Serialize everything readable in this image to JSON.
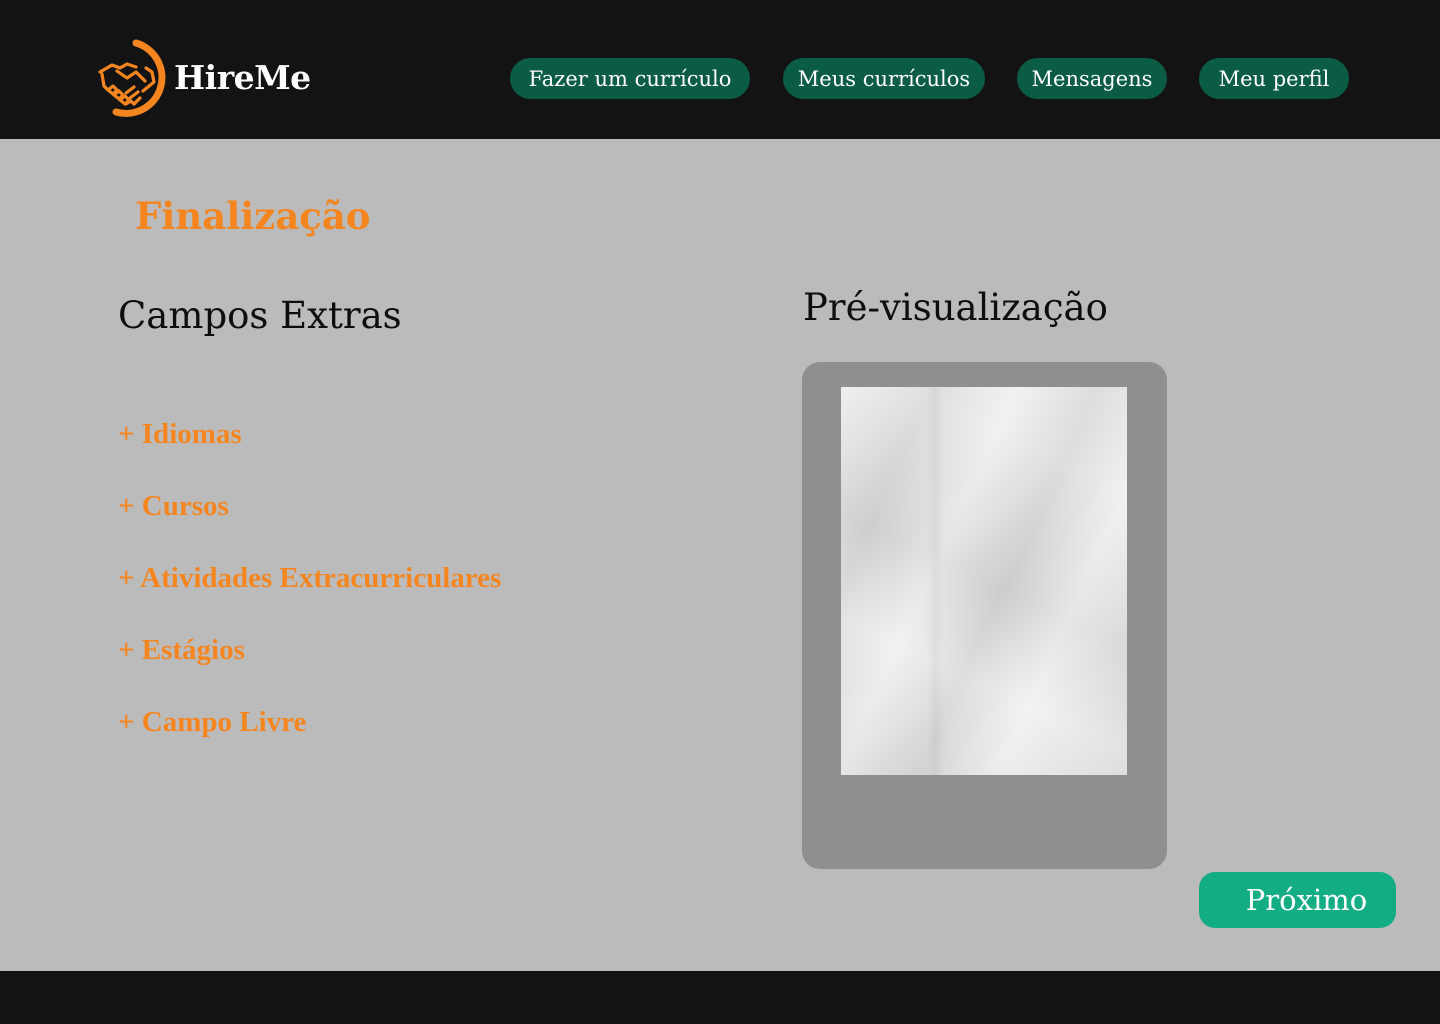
{
  "app": {
    "name": "HireMe"
  },
  "nav": {
    "items": [
      {
        "label": "Fazer um currículo"
      },
      {
        "label": "Meus currículos"
      },
      {
        "label": "Mensagens"
      },
      {
        "label": "Meu perfil"
      }
    ]
  },
  "main": {
    "title": "Finalização",
    "extras": {
      "heading": "Campos Extras",
      "items": [
        {
          "label": "+ Idiomas"
        },
        {
          "label": "+ Cursos"
        },
        {
          "label": "+ Atividades Extracurriculares"
        },
        {
          "label": "+ Estágios"
        },
        {
          "label": "+ Campo Livre"
        }
      ]
    },
    "preview": {
      "heading": "Pré-visualização"
    },
    "next_label": "Próximo"
  },
  "icons": {
    "logo": "handshake-icon"
  },
  "colors": {
    "accent": "#f5861f",
    "nav_button": "#0b5c45",
    "primary_button": "#13ad83",
    "header_bg": "#131313",
    "page_bg": "#bbbbbb",
    "preview_frame": "#8f8f8f"
  }
}
